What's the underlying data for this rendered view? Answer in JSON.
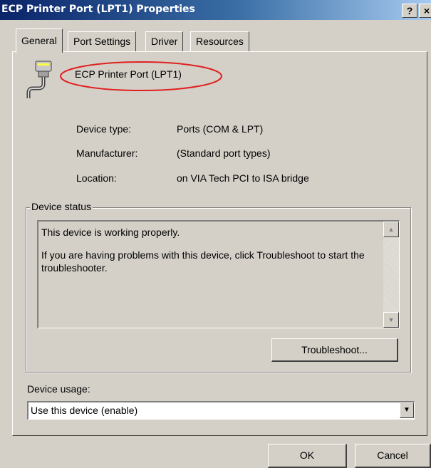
{
  "window": {
    "title": "ECP Printer Port (LPT1) Properties",
    "help_button": "?",
    "close_button": "×"
  },
  "tabs": [
    {
      "label": "General",
      "active": true
    },
    {
      "label": "Port Settings",
      "active": false
    },
    {
      "label": "Driver",
      "active": false
    },
    {
      "label": "Resources",
      "active": false
    }
  ],
  "device": {
    "name": "ECP Printer Port (LPT1)",
    "icon": "parallel-port-icon",
    "highlight_color": "#e02020",
    "properties": [
      {
        "label": "Device type:",
        "value": "Ports (COM & LPT)"
      },
      {
        "label": "Manufacturer:",
        "value": "(Standard port types)"
      },
      {
        "label": "Location:",
        "value": "on VIA Tech PCI to ISA bridge"
      }
    ]
  },
  "device_status": {
    "legend": "Device status",
    "line1": "This device is working properly.",
    "line2": "If you are having problems with this device, click Troubleshoot to start the troubleshooter.",
    "troubleshoot_button": "Troubleshoot..."
  },
  "device_usage": {
    "label": "Device usage:",
    "selected": "Use this device (enable)"
  },
  "footer": {
    "ok_button": "OK",
    "cancel_button": "Cancel"
  }
}
